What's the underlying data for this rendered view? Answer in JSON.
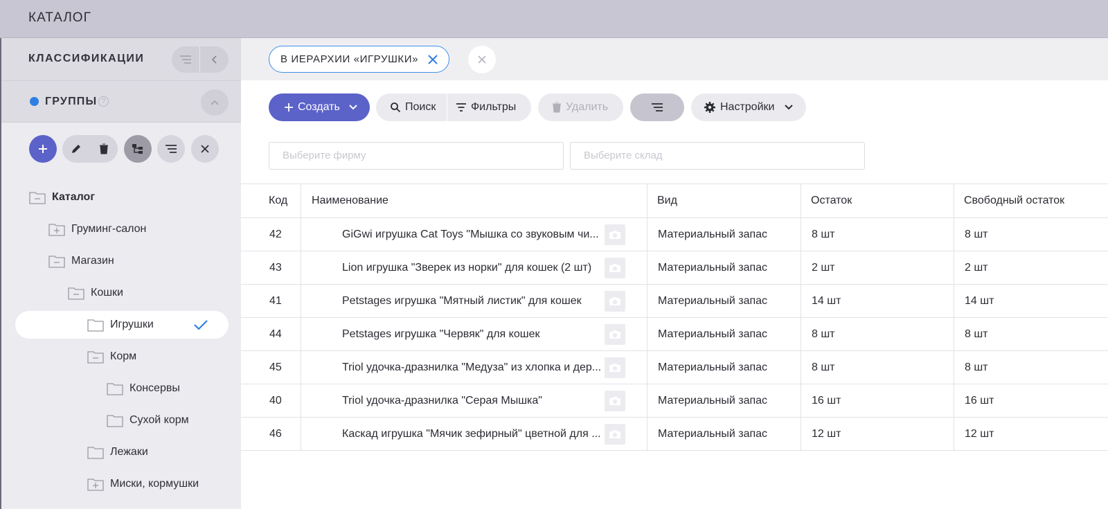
{
  "topbar": {
    "title": "КАТАЛОГ"
  },
  "sidebar": {
    "header_label": "КЛАССИФИКАЦИИ",
    "groups_label": "ГРУППЫ",
    "help_glyph": "?",
    "tree": [
      {
        "label": "Каталог",
        "expanded": true
      },
      {
        "label": "Груминг-салон",
        "expanded": false
      },
      {
        "label": "Магазин",
        "expanded": true
      },
      {
        "label": "Кошки",
        "expanded": true
      },
      {
        "label": "Игрушки",
        "selected": true
      },
      {
        "label": "Корм",
        "expanded": true
      },
      {
        "label": "Консервы"
      },
      {
        "label": "Сухой корм"
      },
      {
        "label": "Лежаки"
      },
      {
        "label": "Миски, кормушки",
        "expanded": false
      }
    ]
  },
  "filter_chip": {
    "label": "В ИЕРАРХИИ «ИГРУШКИ»"
  },
  "toolbar": {
    "create_label": "Создать",
    "search_label": "Поиск",
    "filters_label": "Фильтры",
    "delete_label": "Удалить",
    "settings_label": "Настройки"
  },
  "selects": {
    "firm_placeholder": "Выберите фирму",
    "warehouse_placeholder": "Выберите склад"
  },
  "table": {
    "columns": [
      "Код",
      "Наименование",
      "Вид",
      "Остаток",
      "Свободный остаток"
    ],
    "rows": [
      {
        "code": "42",
        "name": "GiGwi игрушка Cat Toys \"Мышка со звуковым чи...",
        "kind": "Материальный запас",
        "stock": "8 шт",
        "free": "8 шт"
      },
      {
        "code": "43",
        "name": "Lion игрушка \"Зверек из норки\" для кошек (2 шт)",
        "kind": "Материальный запас",
        "stock": "2 шт",
        "free": "2 шт"
      },
      {
        "code": "41",
        "name": "Petstages игрушка \"Мятный листик\" для кошек",
        "kind": "Материальный запас",
        "stock": "14 шт",
        "free": "14 шт"
      },
      {
        "code": "44",
        "name": "Petstages игрушка \"Червяк\" для кошек",
        "kind": "Материальный запас",
        "stock": "8 шт",
        "free": "8 шт"
      },
      {
        "code": "45",
        "name": "Triol удочка-дразнилка \"Медуза\" из хлопка и дер...",
        "kind": "Материальный запас",
        "stock": "8 шт",
        "free": "8 шт"
      },
      {
        "code": "40",
        "name": "Triol удочка-дразнилка \"Серая Мышка\"",
        "kind": "Материальный запас",
        "stock": "16 шт",
        "free": "16 шт"
      },
      {
        "code": "46",
        "name": "Каскад игрушка \"Мячик зефирный\" цветной для ...",
        "kind": "Материальный запас",
        "stock": "12 шт",
        "free": "12 шт"
      }
    ]
  },
  "colors": {
    "accent": "#5b62c8",
    "chip_border": "#3f8fe8",
    "check": "#2f7fe3",
    "groups_dot": "#2f7fe3"
  }
}
